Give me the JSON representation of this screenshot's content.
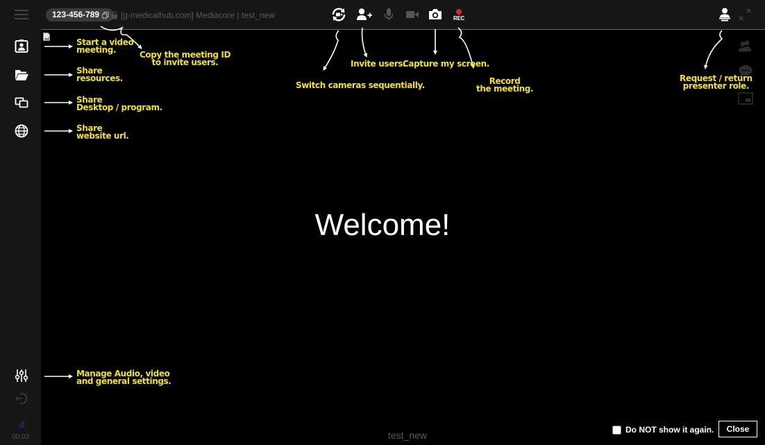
{
  "header": {
    "meeting_id": "123-456-789",
    "meeting_info": "[g-medicalhub.com] Mediacore | test_new"
  },
  "icons": {
    "menu": "hamburger-menu-icon",
    "copy": "copy-icon",
    "lock": "lock-icon",
    "switch_camera": "switch-camera-icon",
    "invite": "add-user-icon",
    "microphone": "microphone-icon",
    "video": "video-camera-icon",
    "capture": "camera-icon",
    "record": "record-icon",
    "presenter": "presenter-icon",
    "fullscreen": "fullscreen-icon"
  },
  "toolbar": {
    "record_label": "REC"
  },
  "sidebar": {
    "timer": "00:03"
  },
  "stage": {
    "welcome": "Welcome!",
    "meeting_name": "test_new"
  },
  "annotations": {
    "video": "Start a video\nmeeting.",
    "copy_id": "Copy the meeting ID\nto invite users.",
    "resources": "Share\nresources.",
    "desktop": "Share\nDesktop / program.",
    "website": "Share\nwebsite url.",
    "switch_cam": "Switch cameras sequentially.",
    "invite": "Invite users.",
    "capture": "Capture my screen.",
    "record": "Record\nthe meeting.",
    "presenter": "Request / return\npresenter role.",
    "settings": "Manage Audio, video\nand general settings."
  },
  "footer": {
    "dont_show": "Do NOT show it again.",
    "close": "Close"
  },
  "colors": {
    "annotation": "#f1e21a",
    "record_dot": "#e0232d",
    "background": "#000000",
    "bar": "#161616"
  }
}
